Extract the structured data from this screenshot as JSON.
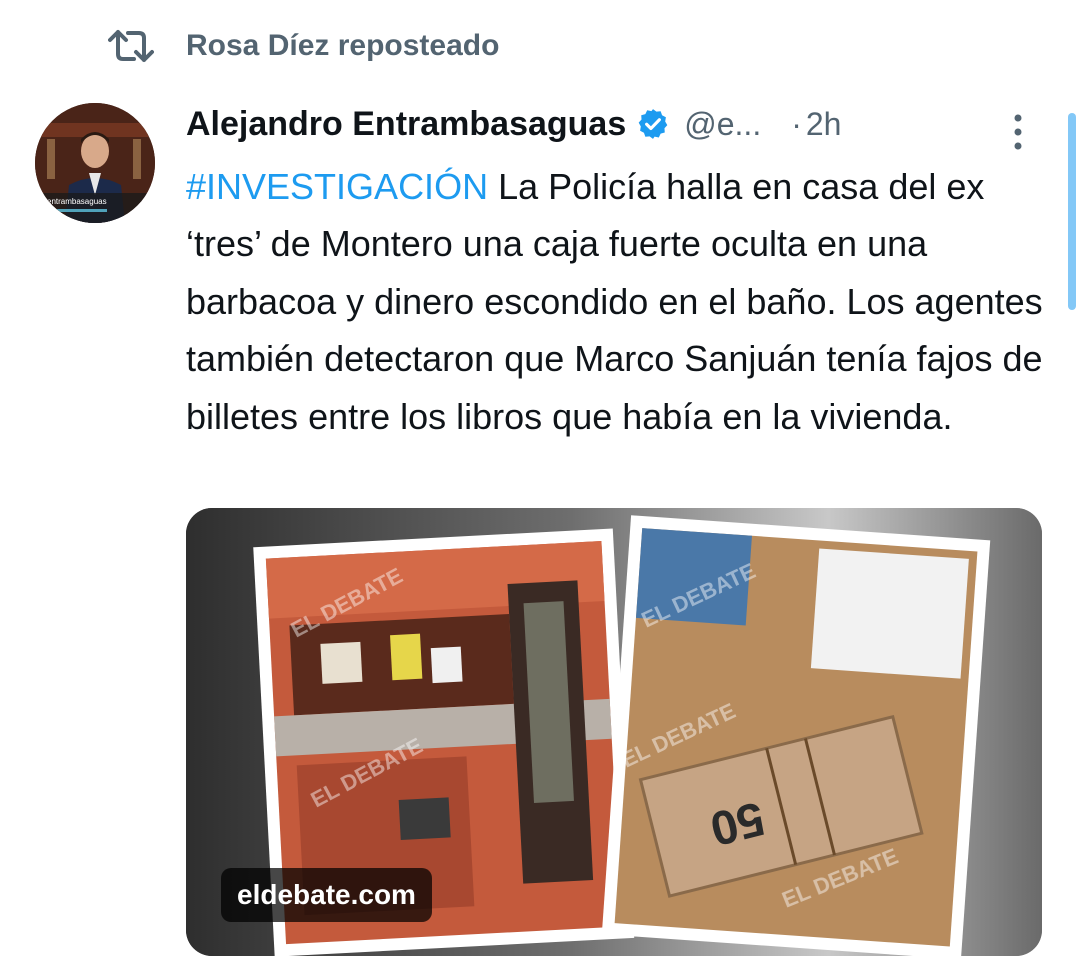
{
  "repost": {
    "label": "Rosa Díez reposteado",
    "icon": "repost-icon"
  },
  "author": {
    "name": "Alejandro Entrambasaguas",
    "handle": "@e...",
    "time": "2h",
    "separator": "·",
    "verified": true,
    "avatar_caption": "entrambasaguas"
  },
  "tweet": {
    "hashtag": "#INVESTIGACIÓN",
    "text": " La Policía halla en casa del ex ‘tres’ de Montero una caja fuerte oculta en una barbacoa y dinero escondido en el baño. Los agentes también detectaron que Marco Sanjuán tenía fajos de billetes entre los libros que había en la vivienda."
  },
  "media": {
    "source_label": "eldebate.com",
    "watermark": "EL DEBATE",
    "banknote_value": "50"
  },
  "colors": {
    "accent": "#1d9bf0",
    "text": "#0f1419",
    "muted": "#536471"
  }
}
